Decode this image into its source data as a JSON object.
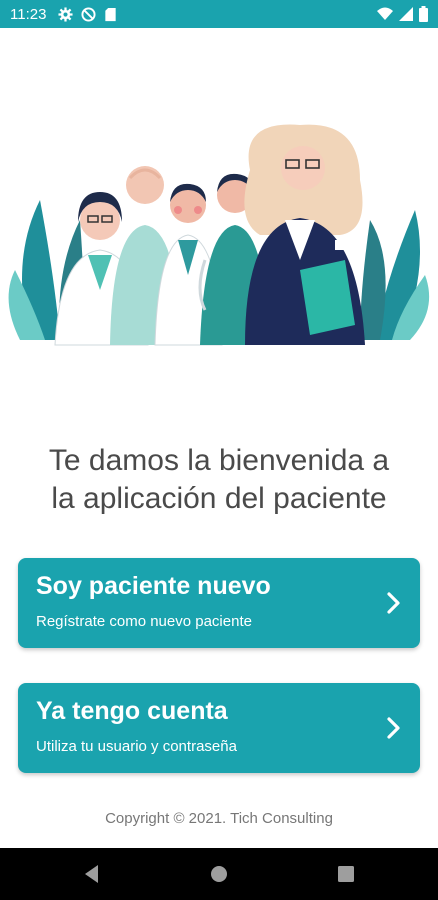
{
  "status_bar": {
    "time": "11:23",
    "left_icons": [
      "gear-icon",
      "do-not-disturb-icon",
      "sd-card-icon"
    ],
    "right_icons": [
      "wifi-icon",
      "signal-icon",
      "battery-icon"
    ]
  },
  "illustration": {
    "subject": "medical-staff-group"
  },
  "welcome": {
    "line1": "Te damos la bienvenida a",
    "line2": "la aplicación del paciente"
  },
  "cards": [
    {
      "title": "Soy paciente nuevo",
      "subtitle": "Regístrate como nuevo paciente",
      "icon": "chevron-right-icon"
    },
    {
      "title": "Ya tengo cuenta",
      "subtitle": "Utiliza tu usuario y contraseña",
      "icon": "chevron-right-icon"
    }
  ],
  "footer": {
    "copyright": "Copyright © 2021. Tich Consulting"
  },
  "nav": {
    "icons": [
      "back-icon",
      "home-icon",
      "recents-icon"
    ]
  },
  "colors": {
    "accent": "#1aa3ae",
    "text": "#4a4a4a",
    "nav": "#000000"
  }
}
